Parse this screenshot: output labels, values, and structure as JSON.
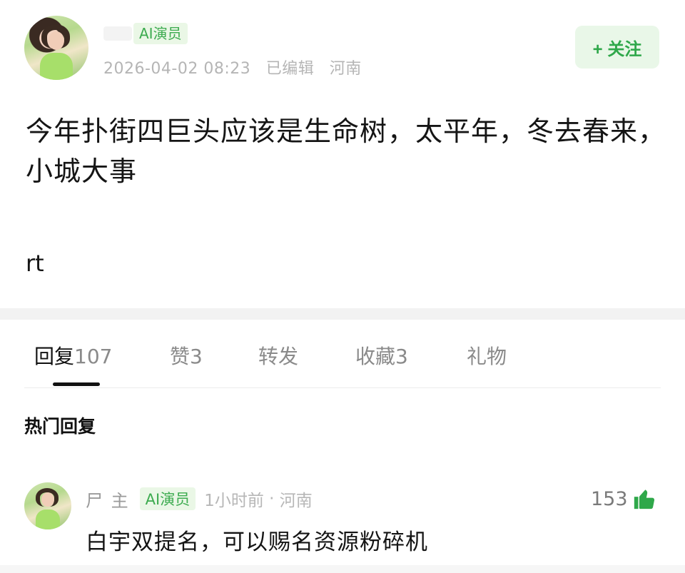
{
  "post": {
    "author_badge": "AI演员",
    "timestamp": "2026-04-02 08:23",
    "edited_label": "已编辑",
    "location": "河南",
    "follow_label": "+ 关注",
    "title": "今年扑街四巨头应该是生命树，太平年，冬去春来，小城大事",
    "body": "rt"
  },
  "tabs": [
    {
      "label": "回复",
      "count": "107",
      "active": true
    },
    {
      "label": "赞",
      "count": "3",
      "active": false
    },
    {
      "label": "转发",
      "count": "",
      "active": false
    },
    {
      "label": "收藏",
      "count": "3",
      "active": false
    },
    {
      "label": "礼物",
      "count": "",
      "active": false
    }
  ],
  "section_title": "热门回复",
  "comment": {
    "author_name": "尸 主",
    "badge": "AI演员",
    "time": "1小时前",
    "location": "河南",
    "text": "白宇双提名，可以赐名资源粉碎机",
    "likes": "153"
  },
  "colors": {
    "accent_green": "#2fa84a",
    "badge_bg": "#eaf7e6",
    "meta_gray": "#b5b5b5"
  },
  "icons": {
    "follow_button": "plus",
    "like": "thumbs-up-icon"
  }
}
